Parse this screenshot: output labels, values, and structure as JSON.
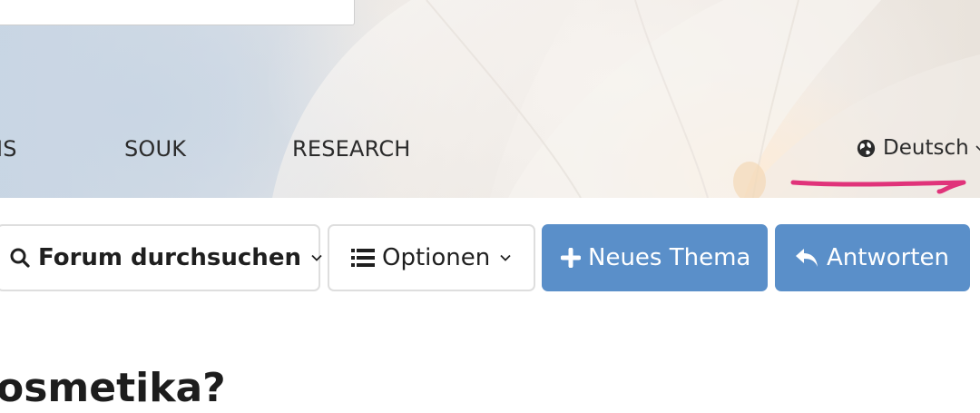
{
  "nav": {
    "items": [
      {
        "label": "IS"
      },
      {
        "label": "SOUK"
      },
      {
        "label": "RESEARCH"
      }
    ],
    "language": {
      "label": "Deutsch",
      "icon": "globe-icon"
    }
  },
  "toolbar": {
    "search_label": "Forum durchsuchen",
    "options_label": "Optionen",
    "new_thread_label": "Neues Thema",
    "reply_label": "Antworten",
    "accent_color": "#5a8fc9"
  },
  "thread": {
    "title_fragment": "osmetika?"
  },
  "annotation": {
    "color": "#e0337a"
  }
}
